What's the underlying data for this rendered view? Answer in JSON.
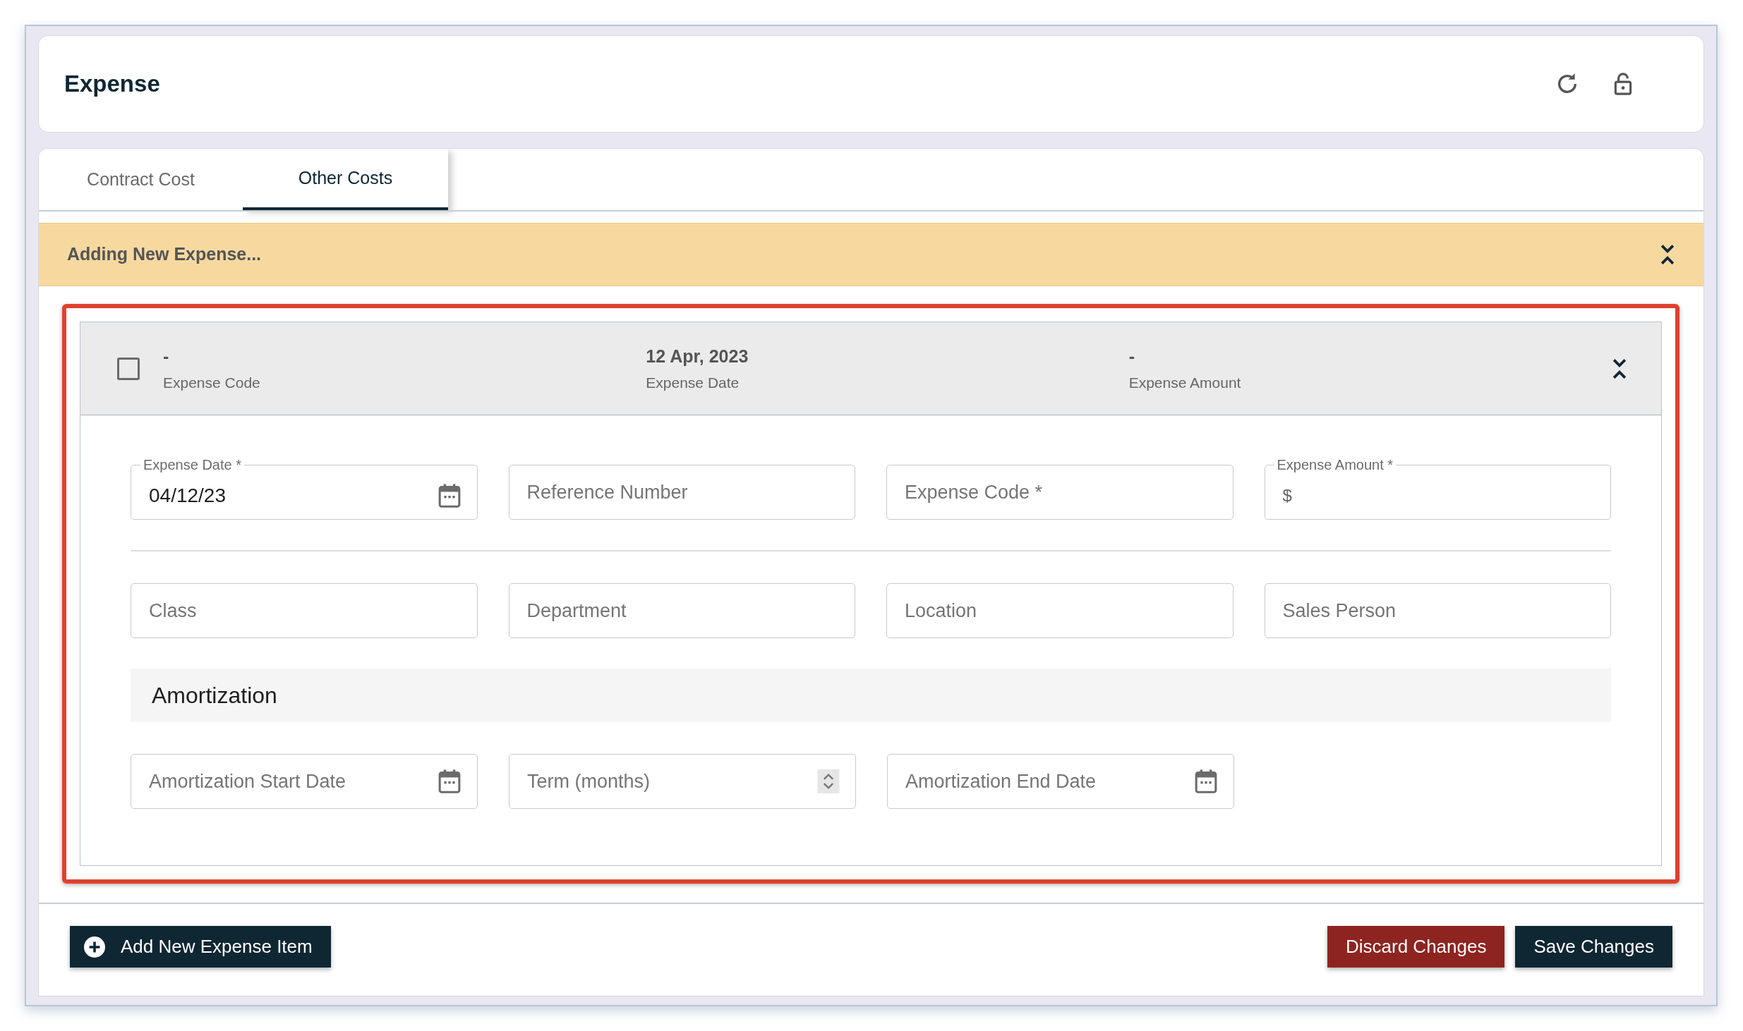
{
  "page": {
    "title": "Expense"
  },
  "tabs": [
    {
      "label": "Contract Cost",
      "selected": false
    },
    {
      "label": "Other Costs",
      "selected": true
    }
  ],
  "banner": {
    "text": "Adding New Expense..."
  },
  "expense_item": {
    "checked": false,
    "summary": [
      {
        "value": "-",
        "label": "Expense Code"
      },
      {
        "value": "12 Apr, 2023",
        "label": "Expense Date"
      },
      {
        "value": "-",
        "label": "Expense Amount"
      }
    ],
    "fields_row_1": [
      {
        "kind": "date",
        "label": "Expense Date *",
        "value": "04/12/23"
      },
      {
        "kind": "text",
        "placeholder": "Reference Number"
      },
      {
        "kind": "text",
        "placeholder": "Expense Code *"
      },
      {
        "kind": "currency",
        "label": "Expense Amount *",
        "value": "$"
      }
    ],
    "fields_row_2": [
      {
        "kind": "text",
        "placeholder": "Class"
      },
      {
        "kind": "text",
        "placeholder": "Department"
      },
      {
        "kind": "text",
        "placeholder": "Location"
      },
      {
        "kind": "text",
        "placeholder": "Sales Person"
      }
    ],
    "section_title": "Amortization",
    "fields_row_3": [
      {
        "kind": "date",
        "placeholder": "Amortization Start Date"
      },
      {
        "kind": "number",
        "placeholder": "Term (months)"
      },
      {
        "kind": "date",
        "placeholder": "Amortization End Date"
      }
    ]
  },
  "footer": {
    "add_button": "Add New Expense Item",
    "discard_button": "Discard Changes",
    "save_button": "Save Changes"
  }
}
